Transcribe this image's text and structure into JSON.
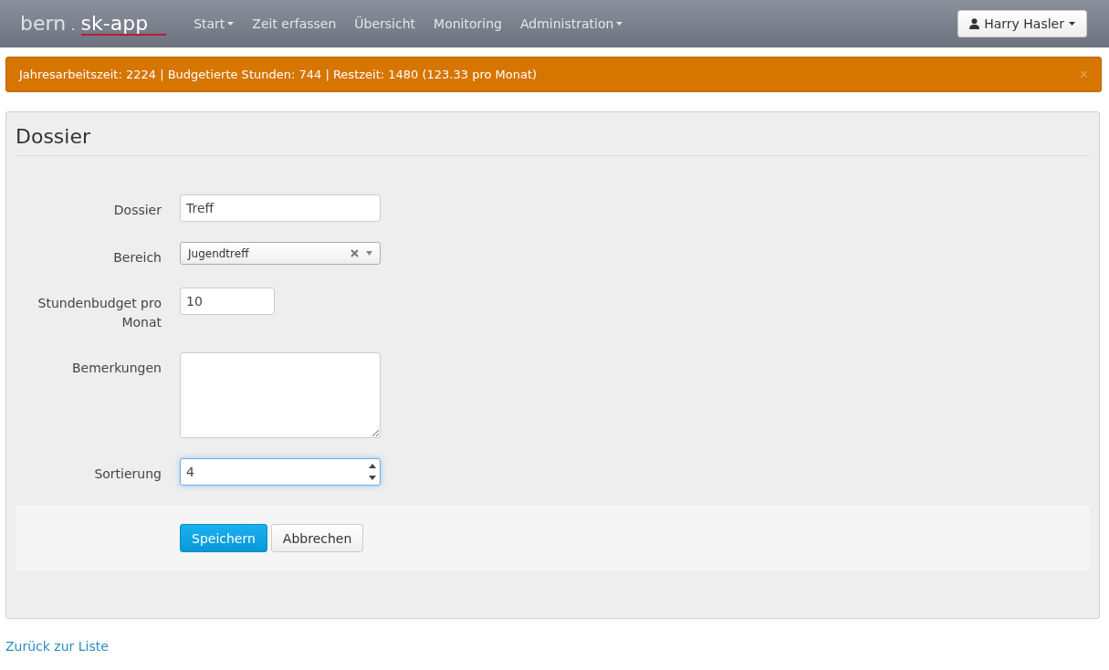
{
  "navbar": {
    "logo": {
      "left": "bern",
      "dot": ".",
      "right": "sk-app"
    },
    "items": [
      {
        "label": "Start",
        "dropdown": true
      },
      {
        "label": "Zeit erfassen",
        "dropdown": false
      },
      {
        "label": "Übersicht",
        "dropdown": false
      },
      {
        "label": "Monitoring",
        "dropdown": false
      },
      {
        "label": "Administration",
        "dropdown": true
      }
    ],
    "user": "Harry Hasler"
  },
  "alert": {
    "text": "Jahresarbeitszeit: 2224 | Budgetierte Stunden: 744 | Restzeit: 1480 (123.33 pro Monat)",
    "close": "×"
  },
  "panel": {
    "title": "Dossier",
    "fields": [
      {
        "kind": "text",
        "label": "Dossier",
        "value": "Treff",
        "focused": false
      },
      {
        "kind": "select",
        "label": "Bereich",
        "value": "Jugendtreff",
        "focused": false
      },
      {
        "kind": "short",
        "label": "Stundenbudget pro Monat",
        "value": "10",
        "focused": false
      },
      {
        "kind": "textarea",
        "label": "Bemerkungen",
        "focused": false
      },
      {
        "kind": "number",
        "label": "Sortierung",
        "value": "4",
        "focused": true
      }
    ],
    "buttons": [
      {
        "label": "Speichern",
        "primary": true
      },
      {
        "label": "Abbrechen",
        "primary": false
      }
    ]
  },
  "back_link": "Zurück zur Liste"
}
